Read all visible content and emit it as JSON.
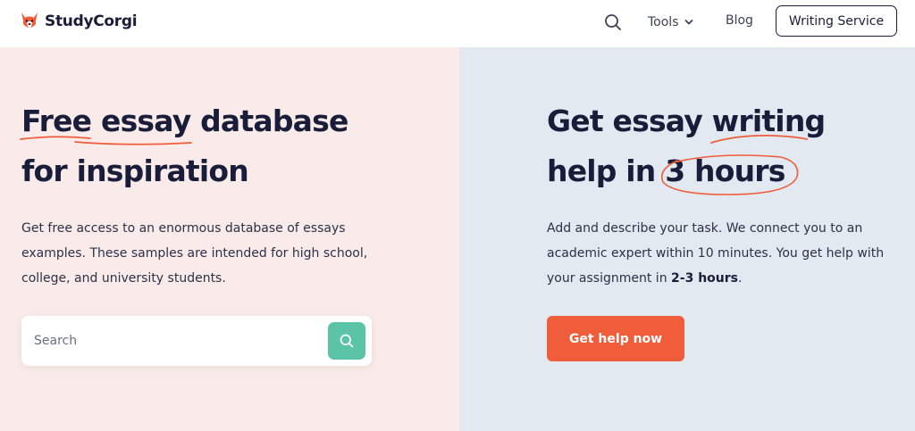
{
  "header": {
    "brand": "StudyCorgi",
    "logo_icon": "corgi-icon",
    "search_icon": "search-icon",
    "nav": {
      "tools_label": "Tools",
      "blog_label": "Blog"
    },
    "cta_label": "Writing Service"
  },
  "left": {
    "title_line1": {
      "pre": "",
      "mark1": "Free",
      "mid": " ",
      "mark2": "essay",
      "post": " database"
    },
    "title_line2": "for inspiration",
    "description": "Get free access to an enormous database of essays examples. These samples are intended for high school, college, and university students.",
    "search": {
      "placeholder": "Search",
      "button_icon": "search-icon"
    }
  },
  "right": {
    "title_line1": {
      "pre": "Get essay ",
      "mark": "writing"
    },
    "title_line2": {
      "pre": "help in ",
      "mark": "3 hours"
    },
    "description_pre": "Add and describe your task. We connect you to an academic expert within 10 minutes. You get help with your assignment in ",
    "description_bold": "2-3 hours",
    "description_post": ".",
    "button_label": "Get help now"
  },
  "colors": {
    "accent_orange": "#f05d3b",
    "search_green": "#5bc4a6",
    "left_bg": "#f8ebe9",
    "right_bg": "#e2e9f0",
    "text_dark": "#1a1d3a"
  }
}
